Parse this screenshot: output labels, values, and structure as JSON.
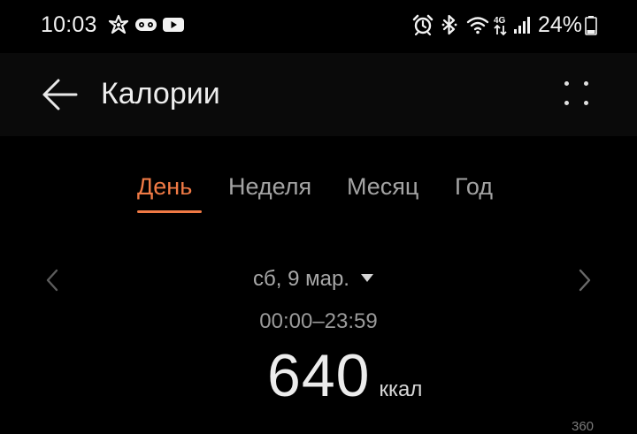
{
  "status_bar": {
    "time": "10:03",
    "battery_percent": "24%",
    "left_icons": [
      "pinwheel-notification-icon",
      "game-controller-icon",
      "youtube-icon"
    ],
    "right_icons": [
      "alarm-icon",
      "bluetooth-icon",
      "wifi-icon",
      "4g-data-icon",
      "signal-icon",
      "battery-icon"
    ]
  },
  "app_bar": {
    "title": "Калории",
    "back_icon": "arrow-left-icon",
    "more_icon": "more-dots-icon"
  },
  "tabs": [
    {
      "label": "День",
      "active": true
    },
    {
      "label": "Неделя",
      "active": false
    },
    {
      "label": "Месяц",
      "active": false
    },
    {
      "label": "Год",
      "active": false
    }
  ],
  "date_nav": {
    "date_label": "сб, 9 мар.",
    "prev_icon": "chevron-left-icon",
    "next_icon": "chevron-right-icon",
    "dropdown_icon": "caret-down-icon"
  },
  "summary": {
    "time_range": "00:00–23:59",
    "value": "640",
    "unit": "ккал"
  },
  "chart": {
    "axis_tick_partial": "360"
  },
  "colors": {
    "accent": "#f07a45",
    "background": "#000000",
    "app_bar_background": "#0a0a0a",
    "text_primary": "#eeeeee",
    "text_secondary": "#a3a3a3"
  }
}
